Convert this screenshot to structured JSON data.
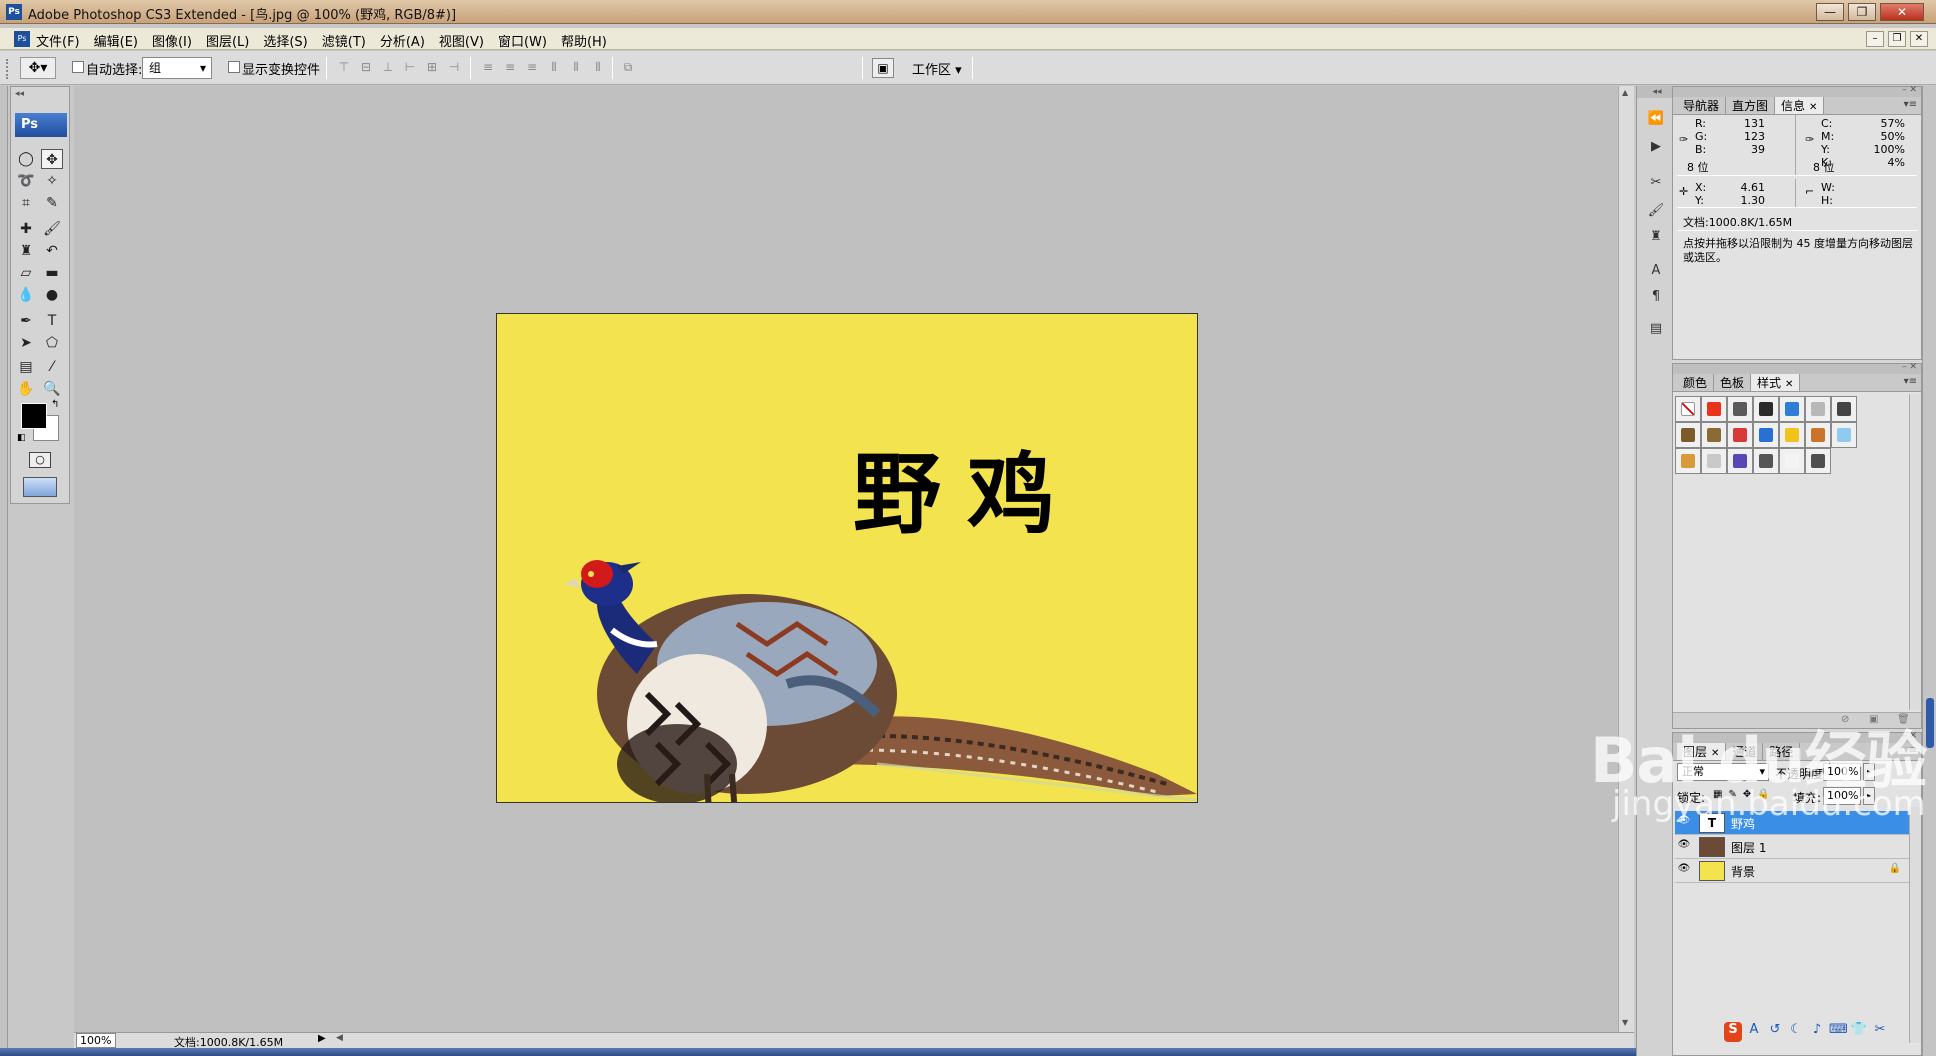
{
  "window": {
    "title": "Adobe Photoshop CS3 Extended - [鸟.jpg @ 100% (野鸡, RGB/8#)]",
    "app_badge": "Ps",
    "controls": [
      "—",
      "❐",
      "✕"
    ]
  },
  "menu": {
    "items": [
      "文件(F)",
      "编辑(E)",
      "图像(I)",
      "图层(L)",
      "选择(S)",
      "滤镜(T)",
      "分析(A)",
      "视图(V)",
      "窗口(W)",
      "帮助(H)"
    ],
    "doc_controls": [
      "–",
      "❐",
      "✕"
    ]
  },
  "options": {
    "tool_icon": "move-tool-icon",
    "auto_select_label": "自动选择:",
    "auto_select_checked": false,
    "auto_select_value": "组",
    "show_transform_label": "显示变换控件",
    "show_transform_checked": false,
    "workspace_label": "工作区 ▾"
  },
  "toolbox": {
    "collapse_label": "◂◂",
    "logo": "Ps",
    "foreground_color": "#000000",
    "background_color": "#ffffff"
  },
  "canvas": {
    "background_color": "#f3e34e",
    "text_layer_content": "野鸡"
  },
  "status": {
    "zoom": "100%",
    "doc_info": "文档:1000.8K/1.65M"
  },
  "info_panel": {
    "tabs": [
      "导航器",
      "直方图",
      "信息"
    ],
    "active_tab": "信息",
    "rgb": [
      {
        "k": "R:",
        "v": "131"
      },
      {
        "k": "G:",
        "v": "123"
      },
      {
        "k": "B:",
        "v": "39"
      }
    ],
    "rgb_depth": "8 位",
    "cmyk": [
      {
        "k": "C:",
        "v": "57%"
      },
      {
        "k": "M:",
        "v": "50%"
      },
      {
        "k": "Y:",
        "v": "100%"
      },
      {
        "k": "K:",
        "v": "4%"
      }
    ],
    "cmyk_depth": "8 位",
    "xy": [
      {
        "k": "X:",
        "v": "4.61"
      },
      {
        "k": "Y:",
        "v": "1.30"
      }
    ],
    "wh": [
      {
        "k": "W:",
        "v": ""
      },
      {
        "k": "H:",
        "v": ""
      }
    ],
    "doc_info": "文档:1000.8K/1.65M",
    "help_text": "点按并拖移以沿限制为 45 度增量方向移动图层或选区。"
  },
  "styles_panel": {
    "tabs": [
      "颜色",
      "色板",
      "样式"
    ],
    "active_tab": "样式",
    "swatches": [
      {
        "name": "no-style",
        "color": "#ffffff"
      },
      {
        "name": "orange-glow",
        "color": "#e8341a"
      },
      {
        "name": "dark-gray",
        "color": "#5a5a5a"
      },
      {
        "name": "black-bevel",
        "color": "#2b2b2b"
      },
      {
        "name": "blue-glass",
        "color": "#2f7ed6"
      },
      {
        "name": "light-gray",
        "color": "#b8b8b8"
      },
      {
        "name": "dark-gradient",
        "color": "#444444"
      },
      {
        "name": "brown-1",
        "color": "#7c5a2a"
      },
      {
        "name": "brown-2",
        "color": "#8c6a35"
      },
      {
        "name": "red",
        "color": "#d83a3a"
      },
      {
        "name": "multicolor",
        "color": "#2a6fd2"
      },
      {
        "name": "yellow-glow",
        "color": "#f2c318"
      },
      {
        "name": "orange-wood",
        "color": "#c9742a"
      },
      {
        "name": "sky-blue",
        "color": "#8fcbf0"
      },
      {
        "name": "landscape",
        "color": "#d99a3a"
      },
      {
        "name": "photo-frame",
        "color": "#c9c9c9"
      },
      {
        "name": "purple",
        "color": "#5b46b5"
      },
      {
        "name": "charcoal",
        "color": "#555555"
      },
      {
        "name": "white",
        "color": "#f4f4f4"
      },
      {
        "name": "slate",
        "color": "#4e4e4e"
      }
    ]
  },
  "layers_panel": {
    "tabs": [
      "图层",
      "通道",
      "路径"
    ],
    "active_tab": "图层",
    "blend_mode": "正常",
    "opacity_label": "不透明度:",
    "opacity": "100%",
    "lock_label": "锁定:",
    "fill_label": "填充:",
    "fill": "100%",
    "layers": [
      {
        "name": "野鸡",
        "thumb": "T",
        "selected": true,
        "locked": false
      },
      {
        "name": "图层 1",
        "thumb": "",
        "selected": false,
        "locked": false
      },
      {
        "name": "背景",
        "thumb": "",
        "selected": false,
        "locked": true
      }
    ]
  },
  "watermark": {
    "brand": "Bai du经验",
    "url": "jingyan.baidu.com"
  },
  "ime": [
    "S",
    "A",
    "↺",
    "☾",
    "♪",
    "⌨",
    "👕",
    "✂"
  ]
}
